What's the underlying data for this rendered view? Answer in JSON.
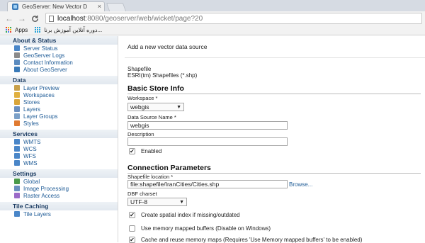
{
  "browser": {
    "tab_title": "GeoServer: New Vector D",
    "tab_close": "×",
    "url_host": "localhost",
    "url_path": ":8080/geoserver/web/wicket/page?20",
    "back": "←",
    "forward": "→",
    "reload": "C",
    "bookmarks": {
      "apps_label": "Apps",
      "persian_label": "دوره آنلاین آموزش برنا..."
    }
  },
  "sidebar": {
    "sections": [
      {
        "title": "About & Status",
        "items": [
          {
            "label": "Server Status",
            "icon": "server-status-icon",
            "color": "#4a86c8"
          },
          {
            "label": "GeoServer Logs",
            "icon": "logs-icon",
            "color": "#8a8a8a"
          },
          {
            "label": "Contact Information",
            "icon": "contact-icon",
            "color": "#5b8bbf"
          },
          {
            "label": "About GeoServer",
            "icon": "about-icon",
            "color": "#3a7ab8"
          }
        ]
      },
      {
        "title": "Data",
        "items": [
          {
            "label": "Layer Preview",
            "icon": "layer-preview-icon",
            "color": "#c8a04a"
          },
          {
            "label": "Workspaces",
            "icon": "workspaces-icon",
            "color": "#e0b040"
          },
          {
            "label": "Stores",
            "icon": "stores-icon",
            "color": "#d9a53a"
          },
          {
            "label": "Layers",
            "icon": "layers-icon",
            "color": "#6a8fbf"
          },
          {
            "label": "Layer Groups",
            "icon": "layer-groups-icon",
            "color": "#7ba0c8"
          },
          {
            "label": "Styles",
            "icon": "styles-icon",
            "color": "#e07a30"
          }
        ]
      },
      {
        "title": "Services",
        "items": [
          {
            "label": "WMTS",
            "icon": "wmts-icon",
            "color": "#4a86c8"
          },
          {
            "label": "WCS",
            "icon": "wcs-icon",
            "color": "#4a86c8"
          },
          {
            "label": "WFS",
            "icon": "wfs-icon",
            "color": "#4a86c8"
          },
          {
            "label": "WMS",
            "icon": "wms-icon",
            "color": "#4a86c8"
          }
        ]
      },
      {
        "title": "Settings",
        "items": [
          {
            "label": "Global",
            "icon": "global-icon",
            "color": "#4a9a4a"
          },
          {
            "label": "Image Processing",
            "icon": "image-processing-icon",
            "color": "#6a8fbf"
          },
          {
            "label": "Raster Access",
            "icon": "raster-access-icon",
            "color": "#9a6ac8"
          }
        ]
      },
      {
        "title": "Tile Caching",
        "items": [
          {
            "label": "Tile Layers",
            "icon": "tile-layers-icon",
            "color": "#4a86c8"
          }
        ]
      }
    ]
  },
  "main": {
    "page_description": "Add a new vector data source",
    "store_type": "Shapefile",
    "store_description": "ESRI(tm) Shapefiles (*.shp)",
    "basic_heading": "Basic Store Info",
    "workspace_label": "Workspace *",
    "workspace_value": "webgis",
    "datasource_label": "Data Source Name *",
    "datasource_value": "webgis",
    "description_label": "Description",
    "description_value": "",
    "enabled_label": "Enabled",
    "enabled_checked": "✔",
    "connection_heading": "Connection Parameters",
    "shapefile_label": "Shapefile location *",
    "shapefile_value": "file:shapefile/IranCities/Cities.shp",
    "browse_label": "Browse...",
    "charset_label": "DBF charset",
    "charset_value": "UTF-8",
    "spatial_index_label": "Create spatial index if missing/outdated",
    "spatial_index_checked": "✔",
    "memory_mapped_label": "Use memory mapped buffers (Disable on Windows)",
    "cache_label": "Cache and reuse memory maps (Requires 'Use Memory mapped buffers' to be enabled)",
    "cache_checked": "✔"
  }
}
